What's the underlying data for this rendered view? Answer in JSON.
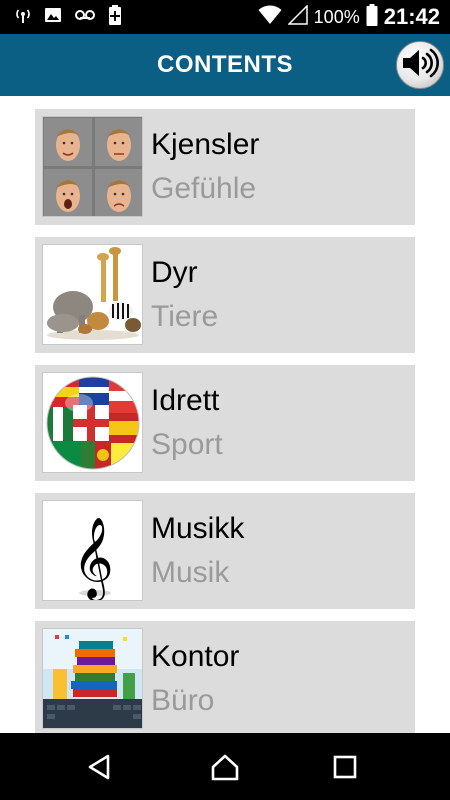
{
  "status_bar": {
    "battery_text": "100%",
    "time": "21:42",
    "icons": [
      "wireless-signal-icon",
      "image-icon",
      "voicemail-icon",
      "battery-plus-icon",
      "wifi-icon",
      "cell-signal-icon",
      "battery-icon"
    ]
  },
  "header": {
    "title": "CONTENTS",
    "sound_icon": "speaker-icon",
    "color": "#0b5f85"
  },
  "categories": [
    {
      "primary": "Kjensler",
      "secondary": "Gefühle",
      "thumb": "faces-thumbnail"
    },
    {
      "primary": "Dyr",
      "secondary": "Tiere",
      "thumb": "animals-thumbnail"
    },
    {
      "primary": "Idrett",
      "secondary": "Sport",
      "thumb": "flag-ball-thumbnail"
    },
    {
      "primary": "Musikk",
      "secondary": "Musik",
      "thumb": "treble-clef-thumbnail"
    },
    {
      "primary": "Kontor",
      "secondary": "Büro",
      "thumb": "office-books-thumbnail"
    }
  ],
  "nav_bar": {
    "icons": [
      "back-icon",
      "home-icon",
      "recents-icon"
    ]
  }
}
